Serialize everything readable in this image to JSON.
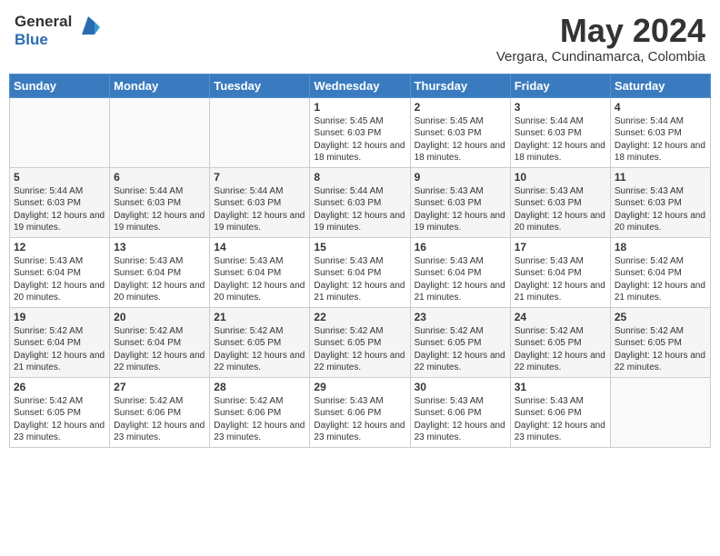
{
  "logo": {
    "line1": "General",
    "line2": "Blue"
  },
  "title": "May 2024",
  "subtitle": "Vergara, Cundinamarca, Colombia",
  "weekdays": [
    "Sunday",
    "Monday",
    "Tuesday",
    "Wednesday",
    "Thursday",
    "Friday",
    "Saturday"
  ],
  "weeks": [
    [
      {
        "day": "",
        "sunrise": "",
        "sunset": "",
        "daylight": ""
      },
      {
        "day": "",
        "sunrise": "",
        "sunset": "",
        "daylight": ""
      },
      {
        "day": "",
        "sunrise": "",
        "sunset": "",
        "daylight": ""
      },
      {
        "day": "1",
        "sunrise": "Sunrise: 5:45 AM",
        "sunset": "Sunset: 6:03 PM",
        "daylight": "Daylight: 12 hours and 18 minutes."
      },
      {
        "day": "2",
        "sunrise": "Sunrise: 5:45 AM",
        "sunset": "Sunset: 6:03 PM",
        "daylight": "Daylight: 12 hours and 18 minutes."
      },
      {
        "day": "3",
        "sunrise": "Sunrise: 5:44 AM",
        "sunset": "Sunset: 6:03 PM",
        "daylight": "Daylight: 12 hours and 18 minutes."
      },
      {
        "day": "4",
        "sunrise": "Sunrise: 5:44 AM",
        "sunset": "Sunset: 6:03 PM",
        "daylight": "Daylight: 12 hours and 18 minutes."
      }
    ],
    [
      {
        "day": "5",
        "sunrise": "Sunrise: 5:44 AM",
        "sunset": "Sunset: 6:03 PM",
        "daylight": "Daylight: 12 hours and 19 minutes."
      },
      {
        "day": "6",
        "sunrise": "Sunrise: 5:44 AM",
        "sunset": "Sunset: 6:03 PM",
        "daylight": "Daylight: 12 hours and 19 minutes."
      },
      {
        "day": "7",
        "sunrise": "Sunrise: 5:44 AM",
        "sunset": "Sunset: 6:03 PM",
        "daylight": "Daylight: 12 hours and 19 minutes."
      },
      {
        "day": "8",
        "sunrise": "Sunrise: 5:44 AM",
        "sunset": "Sunset: 6:03 PM",
        "daylight": "Daylight: 12 hours and 19 minutes."
      },
      {
        "day": "9",
        "sunrise": "Sunrise: 5:43 AM",
        "sunset": "Sunset: 6:03 PM",
        "daylight": "Daylight: 12 hours and 19 minutes."
      },
      {
        "day": "10",
        "sunrise": "Sunrise: 5:43 AM",
        "sunset": "Sunset: 6:03 PM",
        "daylight": "Daylight: 12 hours and 20 minutes."
      },
      {
        "day": "11",
        "sunrise": "Sunrise: 5:43 AM",
        "sunset": "Sunset: 6:03 PM",
        "daylight": "Daylight: 12 hours and 20 minutes."
      }
    ],
    [
      {
        "day": "12",
        "sunrise": "Sunrise: 5:43 AM",
        "sunset": "Sunset: 6:04 PM",
        "daylight": "Daylight: 12 hours and 20 minutes."
      },
      {
        "day": "13",
        "sunrise": "Sunrise: 5:43 AM",
        "sunset": "Sunset: 6:04 PM",
        "daylight": "Daylight: 12 hours and 20 minutes."
      },
      {
        "day": "14",
        "sunrise": "Sunrise: 5:43 AM",
        "sunset": "Sunset: 6:04 PM",
        "daylight": "Daylight: 12 hours and 20 minutes."
      },
      {
        "day": "15",
        "sunrise": "Sunrise: 5:43 AM",
        "sunset": "Sunset: 6:04 PM",
        "daylight": "Daylight: 12 hours and 21 minutes."
      },
      {
        "day": "16",
        "sunrise": "Sunrise: 5:43 AM",
        "sunset": "Sunset: 6:04 PM",
        "daylight": "Daylight: 12 hours and 21 minutes."
      },
      {
        "day": "17",
        "sunrise": "Sunrise: 5:43 AM",
        "sunset": "Sunset: 6:04 PM",
        "daylight": "Daylight: 12 hours and 21 minutes."
      },
      {
        "day": "18",
        "sunrise": "Sunrise: 5:42 AM",
        "sunset": "Sunset: 6:04 PM",
        "daylight": "Daylight: 12 hours and 21 minutes."
      }
    ],
    [
      {
        "day": "19",
        "sunrise": "Sunrise: 5:42 AM",
        "sunset": "Sunset: 6:04 PM",
        "daylight": "Daylight: 12 hours and 21 minutes."
      },
      {
        "day": "20",
        "sunrise": "Sunrise: 5:42 AM",
        "sunset": "Sunset: 6:04 PM",
        "daylight": "Daylight: 12 hours and 22 minutes."
      },
      {
        "day": "21",
        "sunrise": "Sunrise: 5:42 AM",
        "sunset": "Sunset: 6:05 PM",
        "daylight": "Daylight: 12 hours and 22 minutes."
      },
      {
        "day": "22",
        "sunrise": "Sunrise: 5:42 AM",
        "sunset": "Sunset: 6:05 PM",
        "daylight": "Daylight: 12 hours and 22 minutes."
      },
      {
        "day": "23",
        "sunrise": "Sunrise: 5:42 AM",
        "sunset": "Sunset: 6:05 PM",
        "daylight": "Daylight: 12 hours and 22 minutes."
      },
      {
        "day": "24",
        "sunrise": "Sunrise: 5:42 AM",
        "sunset": "Sunset: 6:05 PM",
        "daylight": "Daylight: 12 hours and 22 minutes."
      },
      {
        "day": "25",
        "sunrise": "Sunrise: 5:42 AM",
        "sunset": "Sunset: 6:05 PM",
        "daylight": "Daylight: 12 hours and 22 minutes."
      }
    ],
    [
      {
        "day": "26",
        "sunrise": "Sunrise: 5:42 AM",
        "sunset": "Sunset: 6:05 PM",
        "daylight": "Daylight: 12 hours and 23 minutes."
      },
      {
        "day": "27",
        "sunrise": "Sunrise: 5:42 AM",
        "sunset": "Sunset: 6:06 PM",
        "daylight": "Daylight: 12 hours and 23 minutes."
      },
      {
        "day": "28",
        "sunrise": "Sunrise: 5:42 AM",
        "sunset": "Sunset: 6:06 PM",
        "daylight": "Daylight: 12 hours and 23 minutes."
      },
      {
        "day": "29",
        "sunrise": "Sunrise: 5:43 AM",
        "sunset": "Sunset: 6:06 PM",
        "daylight": "Daylight: 12 hours and 23 minutes."
      },
      {
        "day": "30",
        "sunrise": "Sunrise: 5:43 AM",
        "sunset": "Sunset: 6:06 PM",
        "daylight": "Daylight: 12 hours and 23 minutes."
      },
      {
        "day": "31",
        "sunrise": "Sunrise: 5:43 AM",
        "sunset": "Sunset: 6:06 PM",
        "daylight": "Daylight: 12 hours and 23 minutes."
      },
      {
        "day": "",
        "sunrise": "",
        "sunset": "",
        "daylight": ""
      }
    ]
  ]
}
